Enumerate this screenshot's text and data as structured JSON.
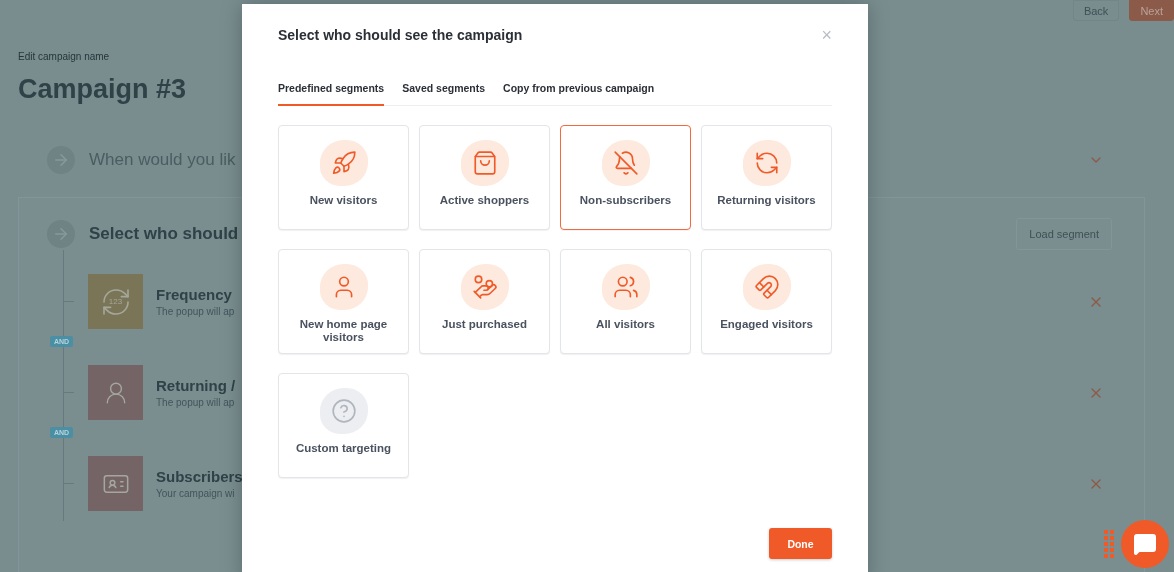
{
  "page": {
    "subtitle": "Edit campaign name",
    "title": "Campaign #3",
    "header_buttons": [
      {
        "label": "Back",
        "kind": "secondary"
      },
      {
        "label": "Next",
        "kind": "primary"
      }
    ]
  },
  "steps": [
    {
      "title": "When would you lik",
      "expanded": false
    },
    {
      "title": "Select who should",
      "expanded": true,
      "action": "Load segment",
      "conditions": [
        {
          "title": "Frequency",
          "description": "The popup will ap",
          "kind": "frequency",
          "icon_text": "123",
          "color": "#7a7556"
        },
        {
          "title": "Returning /",
          "description": "The popup will ap",
          "kind": "returning",
          "color": "#746466"
        },
        {
          "title": "Subscribers",
          "description": "Your campaign wi",
          "kind": "subscribers",
          "color": "#746466"
        }
      ],
      "connectors": [
        "AND",
        "AND"
      ]
    }
  ],
  "modal": {
    "title": "Select who should see the campaign",
    "close": "×",
    "tabs": [
      {
        "label": "Predefined segments",
        "selected": true
      },
      {
        "label": "Saved segments",
        "selected": false
      },
      {
        "label": "Copy from previous campaign",
        "selected": false
      }
    ],
    "segments": [
      {
        "label": "New visitors",
        "kind": "rocket",
        "selected": false
      },
      {
        "label": "Active shoppers",
        "kind": "bag",
        "selected": false
      },
      {
        "label": "Non-subscribers",
        "kind": "bell-off",
        "selected": true
      },
      {
        "label": "Returning visitors",
        "kind": "returning",
        "selected": false
      },
      {
        "label": "New home page visitors",
        "kind": "home-visitor",
        "selected": false
      },
      {
        "label": "Just purchased",
        "kind": "purchase",
        "selected": false
      },
      {
        "label": "All visitors",
        "kind": "group",
        "selected": false
      },
      {
        "label": "Engaged visitors",
        "kind": "magnet",
        "selected": false
      },
      {
        "label": "Custom targeting",
        "kind": "custom",
        "selected": false
      }
    ],
    "done": "Done"
  }
}
